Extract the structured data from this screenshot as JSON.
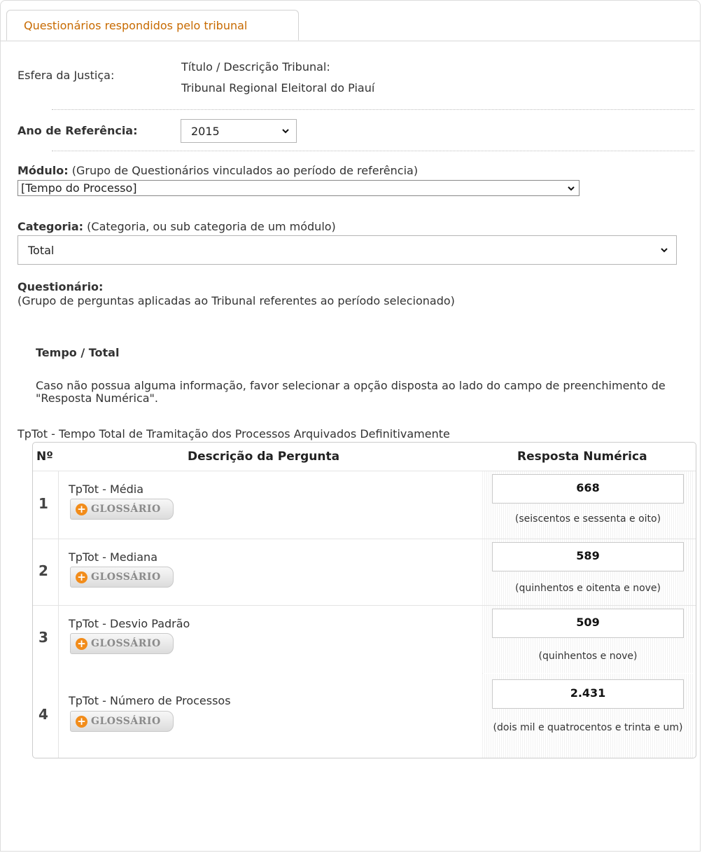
{
  "tab": {
    "label": "Questionários respondidos pelo tribunal"
  },
  "esfera": {
    "label": "Esfera da Justiça:"
  },
  "titulo": {
    "label": "Título / Descrição Tribunal:",
    "value": "Tribunal Regional Eleitoral do Piauí"
  },
  "ano": {
    "label": "Ano de Referência:",
    "selected": "2015"
  },
  "modulo": {
    "label": "Módulo:",
    "hint": "(Grupo de Questionários vinculados ao período de referência)",
    "selected": "[Tempo do Processo]"
  },
  "categoria": {
    "label": "Categoria:",
    "hint": "(Categoria, ou sub categoria de um módulo)",
    "selected": "Total"
  },
  "questionario": {
    "label": "Questionário:",
    "hint": "(Grupo de perguntas aplicadas ao Tribunal referentes ao período selecionado)"
  },
  "section": {
    "title": "Tempo / Total",
    "note": "Caso não possua alguma informação, favor selecionar a opção disposta ao lado do campo de preenchimento de \"Resposta Numérica\"."
  },
  "table": {
    "caption": "TpTot - Tempo Total de Tramitação dos Processos Arquivados Definitivamente",
    "headers": {
      "num": "Nº",
      "desc": "Descrição da Pergunta",
      "resp": "Resposta Numérica"
    },
    "glossario_label": "GLOSSÁRIO",
    "rows": [
      {
        "num": "1",
        "desc": "TpTot - Média",
        "value": "668",
        "extenso": "(seiscentos e sessenta e oito)"
      },
      {
        "num": "2",
        "desc": "TpTot - Mediana",
        "value": "589",
        "extenso": "(quinhentos e oitenta e nove)"
      },
      {
        "num": "3",
        "desc": "TpTot - Desvio Padrão",
        "value": "509",
        "extenso": "(quinhentos e nove)"
      },
      {
        "num": "4",
        "desc": "TpTot - Número de Processos",
        "value": "2.431",
        "extenso": "(dois mil e quatrocentos e trinta e um)"
      }
    ]
  },
  "colors": {
    "tab_text": "#c76a00",
    "glossary_plus": "#f28c1a"
  },
  "icons": {
    "select_arrow": "chevron-down-icon",
    "glossary": "plus-circle-icon"
  }
}
